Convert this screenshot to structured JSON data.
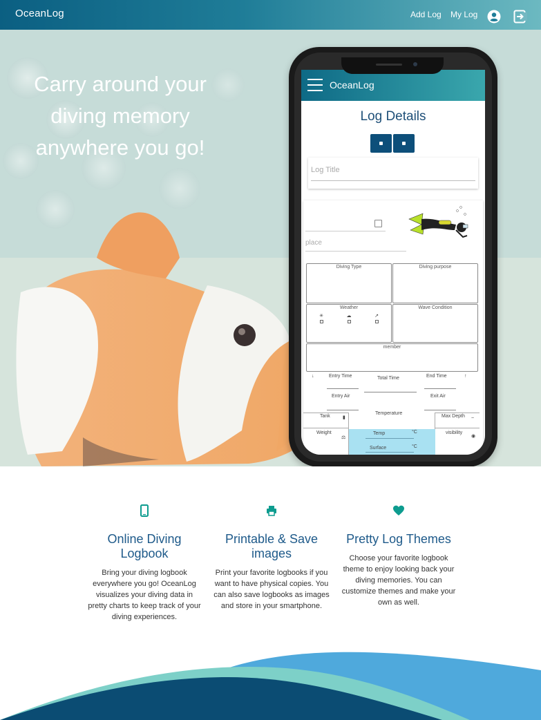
{
  "brand": "OceanLog",
  "nav": {
    "add_log": "Add Log",
    "my_log": "My Log",
    "user_icon": "user-circle-icon",
    "logout_icon": "sign-out-icon"
  },
  "hero": {
    "line1": "Carry around your",
    "line2": "diving memory",
    "line3": "anywhere you go!"
  },
  "phone": {
    "app_title": "OceanLog",
    "page_title": "Log Details",
    "title_placeholder": "Log Title",
    "place_placeholder": "place",
    "diving_type": "Diving Type",
    "diving_purpose": "Diving purpose",
    "weather": "Weather",
    "wave_condition": "Wave Condition",
    "member": "member",
    "entry_time": "Entry Time",
    "total_time": "Total Time",
    "end_time": "End Time",
    "entry_air": "Entry Air",
    "exit_air": "Exit Air",
    "temperature": "Temperature",
    "tank": "Tank",
    "max_depth": "Max Depth",
    "weight": "Weight",
    "temp": "Temp",
    "visibility": "visibility",
    "surface": "Surface",
    "celsius": "°C"
  },
  "features": [
    {
      "icon": "mobile-icon",
      "title": "Online Diving Logbook",
      "desc": "Bring your diving logbook everywhere you go! OceanLog visualizes your diving data in pretty charts to keep track of your diving experiences."
    },
    {
      "icon": "printer-icon",
      "title": "Printable & Save images",
      "desc": "Print your favorite logbooks if you want to have physical copies. You can also save logbooks as images and store in your smartphone."
    },
    {
      "icon": "heart-icon",
      "title": "Pretty Log Themes",
      "desc": "Choose your favorite logbook theme to enjoy looking back your diving memories. You can customize themes and make your own as well."
    }
  ],
  "colors": {
    "accent": "#0d9c8f",
    "heading": "#1e5a8a",
    "navy": "#0b4c73",
    "wave_light": "#7dd0c8",
    "wave_blue": "#4fa9dc"
  }
}
